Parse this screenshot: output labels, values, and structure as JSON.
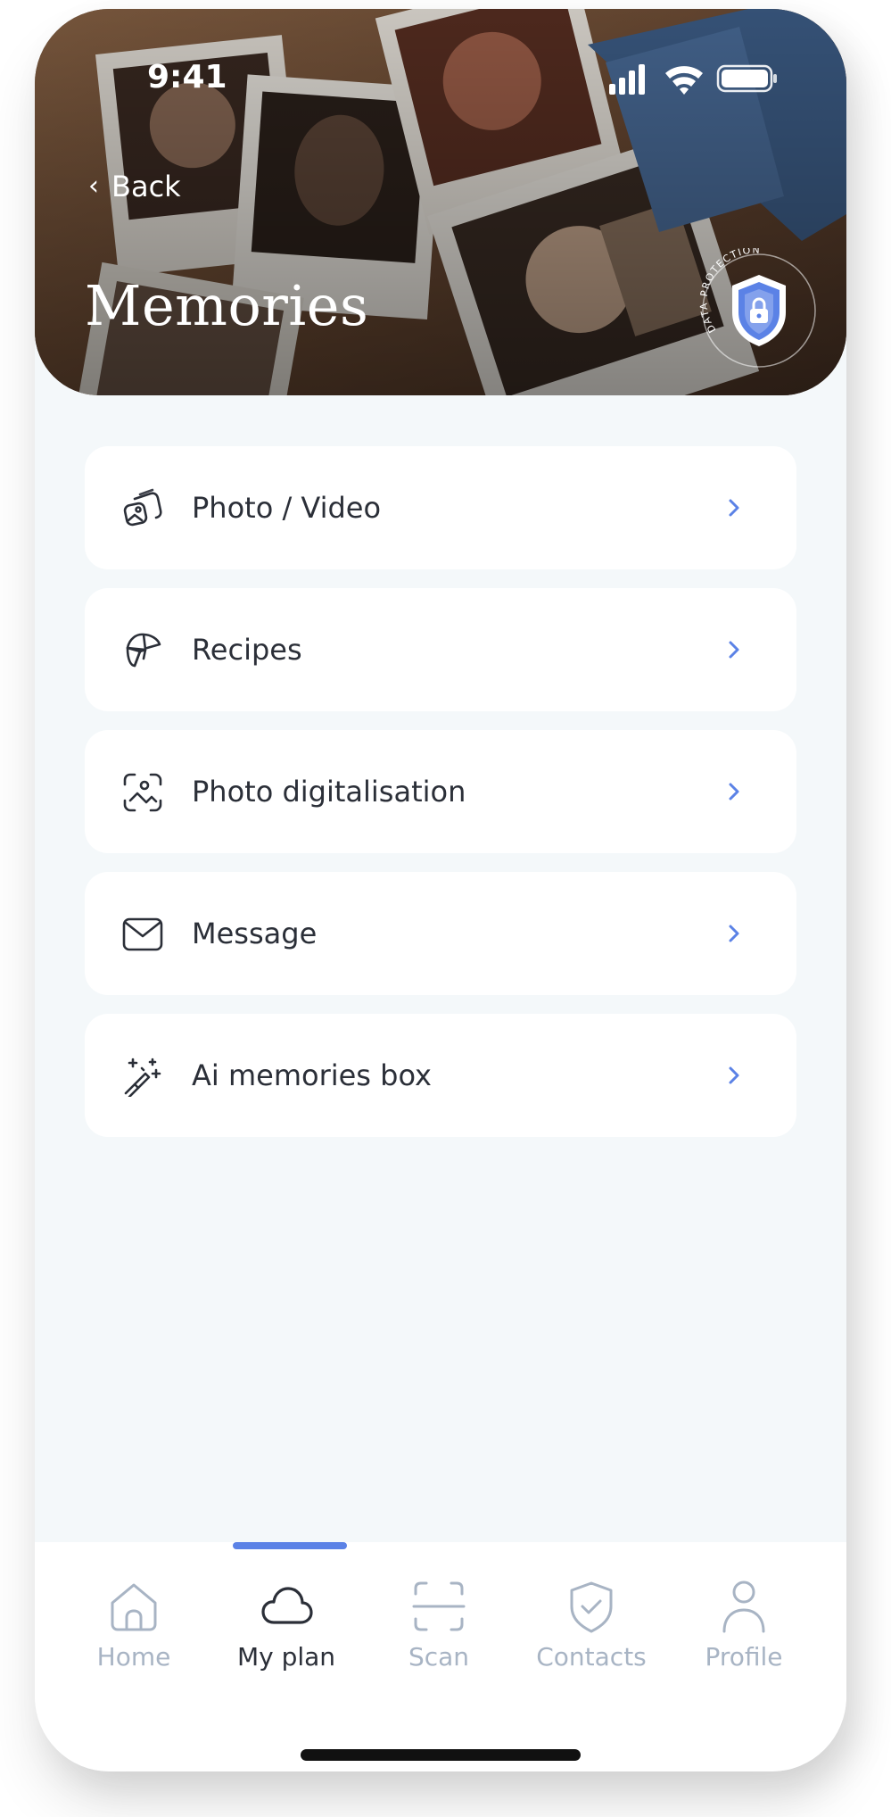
{
  "status_bar": {
    "time": "9:41",
    "icons": [
      "cellular-signal-icon",
      "wifi-icon",
      "battery-icon"
    ]
  },
  "header": {
    "back_label": "Back",
    "title": "Memories",
    "badge_text": "DATA PROTECTION",
    "badge_icon": "shield-lock-icon"
  },
  "menu": {
    "items": [
      {
        "label": "Photo / Video",
        "icon": "photo-stack-icon"
      },
      {
        "label": "Recipes",
        "icon": "croissant-icon"
      },
      {
        "label": "Photo digitalisation",
        "icon": "scan-photo-icon"
      },
      {
        "label": "Message",
        "icon": "envelope-icon"
      },
      {
        "label": "Ai memories box",
        "icon": "magic-wand-icon"
      }
    ]
  },
  "tabbar": {
    "active": "My plan",
    "tabs": [
      {
        "label": "Home",
        "icon": "home-icon"
      },
      {
        "label": "My plan",
        "icon": "cloud-icon"
      },
      {
        "label": "Scan",
        "icon": "scan-frame-icon"
      },
      {
        "label": "Contacts",
        "icon": "shield-check-icon"
      },
      {
        "label": "Profile",
        "icon": "user-icon"
      }
    ]
  },
  "colors": {
    "accent": "#5b82e6",
    "text": "#2b2f38",
    "inactive": "#a8b4c4",
    "background": "#f4f8fa"
  }
}
